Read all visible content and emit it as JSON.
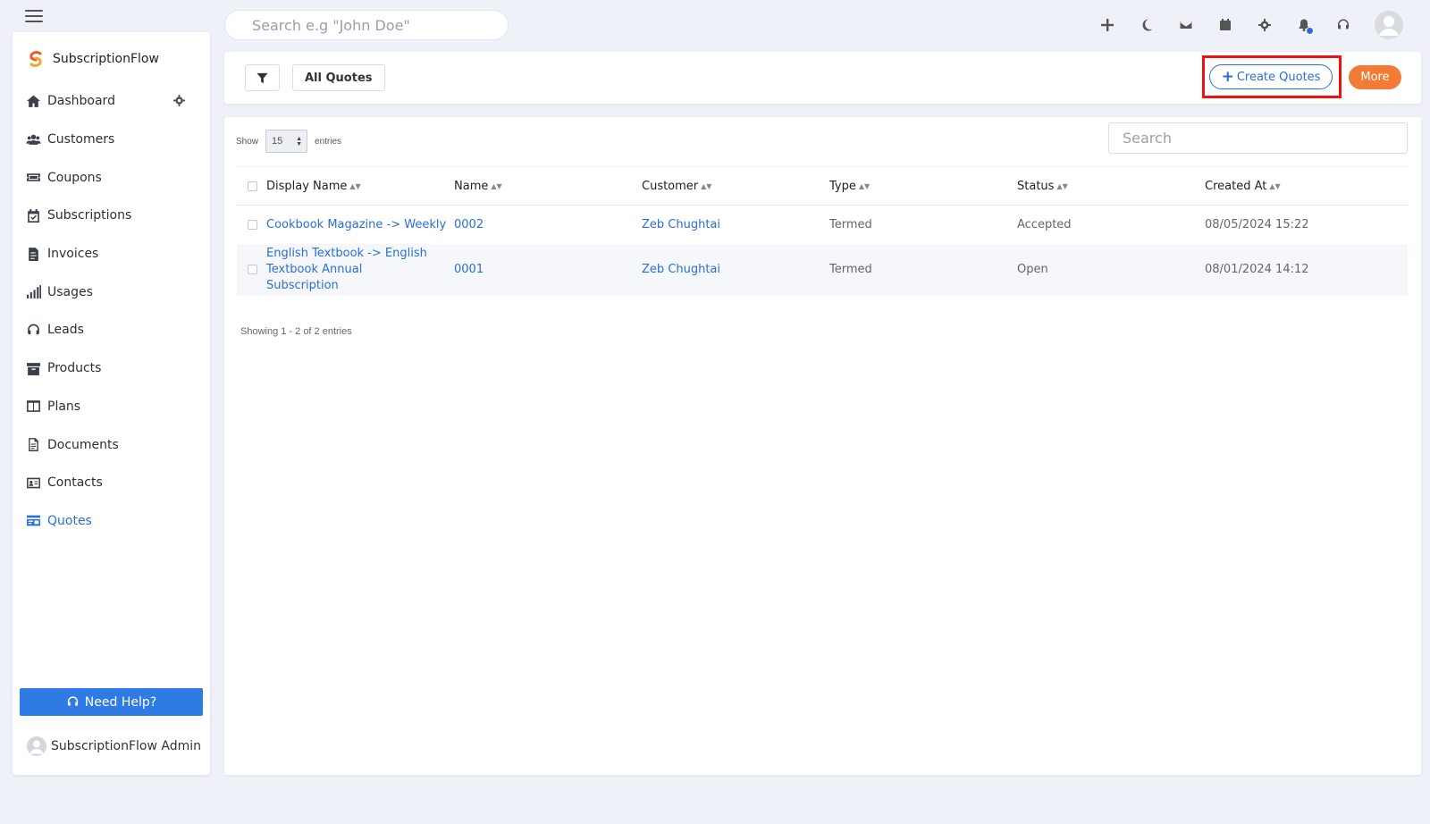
{
  "topbar": {
    "search_placeholder": "Search e.g \"John Doe\"",
    "icons": [
      "plus-icon",
      "moon-icon",
      "mail-icon",
      "calendar-icon",
      "gear-icon",
      "bell-icon",
      "headset-icon",
      "avatar"
    ]
  },
  "sidebar": {
    "brand": "SubscriptionFlow",
    "items": [
      {
        "label": "Dashboard",
        "icon": "home-icon"
      },
      {
        "label": "Customers",
        "icon": "users-icon"
      },
      {
        "label": "Coupons",
        "icon": "ticket-icon"
      },
      {
        "label": "Subscriptions",
        "icon": "calendar-check-icon"
      },
      {
        "label": "Invoices",
        "icon": "invoice-icon"
      },
      {
        "label": "Usages",
        "icon": "signal-icon"
      },
      {
        "label": "Leads",
        "icon": "headset-icon"
      },
      {
        "label": "Products",
        "icon": "archive-icon"
      },
      {
        "label": "Plans",
        "icon": "columns-icon"
      },
      {
        "label": "Documents",
        "icon": "file-icon"
      },
      {
        "label": "Contacts",
        "icon": "id-card-icon"
      },
      {
        "label": "Quotes",
        "icon": "quote-card-icon",
        "active": true
      }
    ],
    "help_label": "Need Help?",
    "admin_name": "SubscriptionFlow Admin"
  },
  "toolbar": {
    "view_label": "All Quotes",
    "create_label": "Create Quotes",
    "more_label": "More"
  },
  "table": {
    "show_label": "Show",
    "entries_value": "15",
    "entries_label": "entries",
    "search_placeholder": "Search",
    "columns": [
      "Display Name",
      "Name",
      "Customer",
      "Type",
      "Status",
      "Created At"
    ],
    "rows": [
      {
        "display_name": "Cookbook Magazine -> Weekly",
        "name": "0002",
        "customer": "Zeb Chughtai",
        "type": "Termed",
        "status": "Accepted",
        "created_at": "08/05/2024 15:22"
      },
      {
        "display_name": "English Textbook -> English Textbook Annual Subscription",
        "name": "0001",
        "customer": "Zeb Chughtai",
        "type": "Termed",
        "status": "Open",
        "created_at": "08/01/2024 14:12"
      }
    ],
    "footer": "Showing 1 - 2 of 2 entries"
  },
  "colors": {
    "accent": "#2b6fd6",
    "more_button": "#f27b35",
    "highlight": "#ee1111"
  }
}
